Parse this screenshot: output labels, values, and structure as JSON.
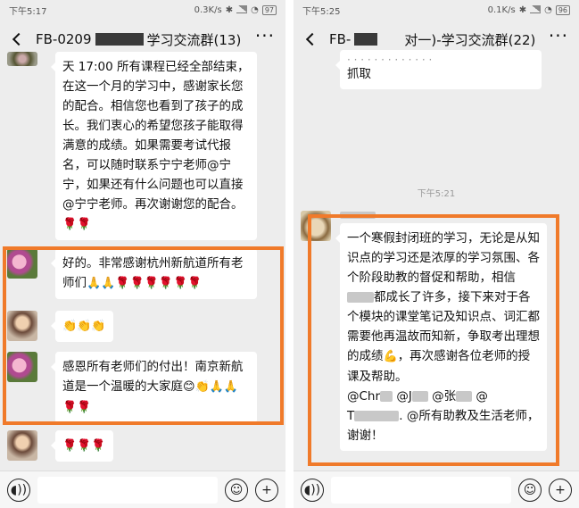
{
  "left": {
    "status": {
      "time": "下午5:17",
      "speed": "0.3K/s",
      "battery": "97"
    },
    "title_prefix": "FB-0209",
    "title_suffix": "学习交流群(13)",
    "messages": [
      {
        "text": "天 17:00 所有课程已经全部结束，在这一个月的学习中，感谢家长您的配合。相信您也看到了孩子的成长。我们衷心的希望您孩子能取得满意的成绩。如果需要考试代报名，可以随时联系宁宁老师@宁宁，如果还有什么问题也可以直接@宁宁老师。再次谢谢您的配合。",
        "emoji": "🌹🌹"
      },
      {
        "text": "好的。非常感谢杭州新航道所有老师们",
        "emoji": "🙏🙏🌹🌹🌹🌹🌹🌹"
      },
      {
        "text": "",
        "emoji": "👏👏👏"
      },
      {
        "text": "感恩所有老师们的付出！南京新航道是一个温暖的大家庭",
        "emoji": "😊👏🙏🙏🌹🌹"
      },
      {
        "text": "",
        "emoji": "🌹🌹🌹"
      }
    ]
  },
  "right": {
    "status": {
      "time": "下午5:25",
      "speed": "0.1K/s",
      "battery": "96"
    },
    "title_prefix": "FB-",
    "title_suffix": "对一)-学习交流群(22)",
    "top_fragment": "抓取",
    "timestamp": "下午5:21",
    "message": {
      "line1": "一个寒假封闭班的学习，无论是从知识点的学习还是浓厚的学习氛围、各个阶段助教的督促和帮助，相信",
      "line2": "都成长了许多，接下来对于各个模块的课堂笔记及知识点、词汇都需要他再温故而知新，争取考出理想的成绩",
      "muscle_emoji": "💪",
      "line3": "，再次感谢各位老师的授课及帮助。",
      "mention1": "@Chr",
      "mention2": "@J",
      "mention3": "@张",
      "mention4": "@",
      "mention5": "T",
      "line4": ". @所有助教及生活老师，谢谢！"
    }
  }
}
